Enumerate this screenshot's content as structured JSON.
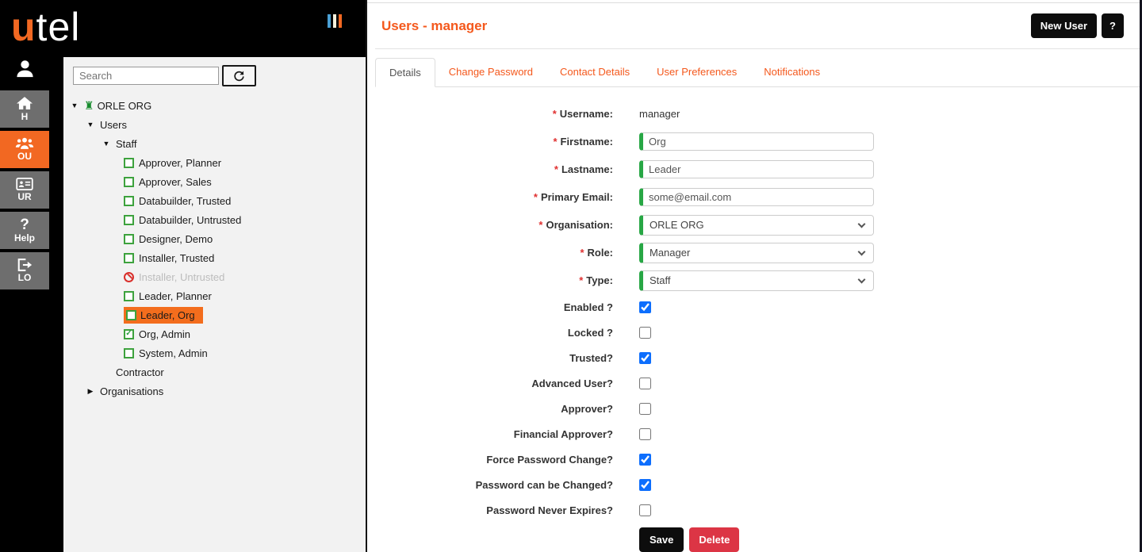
{
  "colors": {
    "brand_orange": "#f26822",
    "title_orange": "#f4581c",
    "selected_tree_bg": "#f36d1d",
    "input_valid_green": "#28a745",
    "tree_check_green": "#3da23d",
    "checkbox_blue": "#0d6efd",
    "delete_red": "#dc3545",
    "rail_gray": "#6e6e6e",
    "tree_panel_bg": "#f2f2f2"
  },
  "brand": {
    "logo_prefix": "u",
    "logo_suffix": "tel"
  },
  "rail": {
    "items": [
      {
        "label": "H",
        "icon": "home-icon",
        "active": false
      },
      {
        "label": "OU",
        "icon": "org-users-icon",
        "active": true
      },
      {
        "label": "UR",
        "icon": "user-card-icon",
        "active": false
      },
      {
        "label": "Help",
        "icon": "question-icon",
        "active": false,
        "icon_glyph": "?"
      },
      {
        "label": "LO",
        "icon": "logout-icon",
        "active": false
      }
    ]
  },
  "sidebar": {
    "search_placeholder": "Search"
  },
  "tree": {
    "items": [
      {
        "label": "ORLE ORG",
        "state": "expanded",
        "icon": "org-rook"
      },
      {
        "label": "Users",
        "state": "expanded"
      },
      {
        "label": "Staff",
        "state": "expanded"
      },
      {
        "label": "Approver, Planner",
        "icon": "checkbox-unchecked"
      },
      {
        "label": "Approver, Sales",
        "icon": "checkbox-unchecked"
      },
      {
        "label": "Databuilder, Trusted",
        "icon": "checkbox-unchecked"
      },
      {
        "label": "Databuilder, Untrusted",
        "icon": "checkbox-unchecked"
      },
      {
        "label": "Designer, Demo",
        "icon": "checkbox-unchecked"
      },
      {
        "label": "Installer, Trusted",
        "icon": "checkbox-unchecked"
      },
      {
        "label": "Installer, Untrusted",
        "icon": "no-entry",
        "disabled": true
      },
      {
        "label": "Leader, Planner",
        "icon": "checkbox-unchecked"
      },
      {
        "label": "Leader, Org",
        "icon": "checkbox-unchecked",
        "selected": true
      },
      {
        "label": "Org, Admin",
        "icon": "checkbox-checked",
        "check_glyph": "✓"
      },
      {
        "label": "System, Admin",
        "icon": "checkbox-unchecked"
      },
      {
        "label": "Contractor"
      },
      {
        "label": "Organisations",
        "state": "collapsed"
      }
    ],
    "expanded_glyph": "▼",
    "collapsed_glyph": "▶",
    "rook_glyph": "♜"
  },
  "header": {
    "title": "Users - manager",
    "new_user_label": "New User",
    "help_label": "?"
  },
  "tabs": [
    {
      "label": "Details",
      "active": true
    },
    {
      "label": "Change Password",
      "active": false
    },
    {
      "label": "Contact Details",
      "active": false
    },
    {
      "label": "User Preferences",
      "active": false
    },
    {
      "label": "Notifications",
      "active": false
    }
  ],
  "form": {
    "required_marker": "*",
    "fields": [
      {
        "label": "Username:",
        "required": true,
        "type": "static",
        "value": "manager"
      },
      {
        "label": "Firstname:",
        "required": true,
        "type": "text",
        "value": "Org"
      },
      {
        "label": "Lastname:",
        "required": true,
        "type": "text",
        "value": "Leader"
      },
      {
        "label": "Primary Email:",
        "required": true,
        "type": "text",
        "value": "some@email.com"
      },
      {
        "label": "Organisation:",
        "required": true,
        "type": "select",
        "value": "ORLE ORG"
      },
      {
        "label": "Role:",
        "required": true,
        "type": "select",
        "value": "Manager"
      },
      {
        "label": "Type:",
        "required": true,
        "type": "select",
        "value": "Staff"
      },
      {
        "label": "Enabled ?",
        "type": "checkbox",
        "checked": true
      },
      {
        "label": "Locked ?",
        "type": "checkbox",
        "checked": false
      },
      {
        "label": "Trusted?",
        "type": "checkbox",
        "checked": true
      },
      {
        "label": "Advanced User?",
        "type": "checkbox",
        "checked": false
      },
      {
        "label": "Approver?",
        "type": "checkbox",
        "checked": false
      },
      {
        "label": "Financial Approver?",
        "type": "checkbox",
        "checked": false
      },
      {
        "label": "Force Password Change?",
        "type": "checkbox",
        "checked": true
      },
      {
        "label": "Password can be Changed?",
        "type": "checkbox",
        "checked": true
      },
      {
        "label": "Password Never Expires?",
        "type": "checkbox",
        "checked": false
      }
    ],
    "save_label": "Save",
    "delete_label": "Delete"
  }
}
